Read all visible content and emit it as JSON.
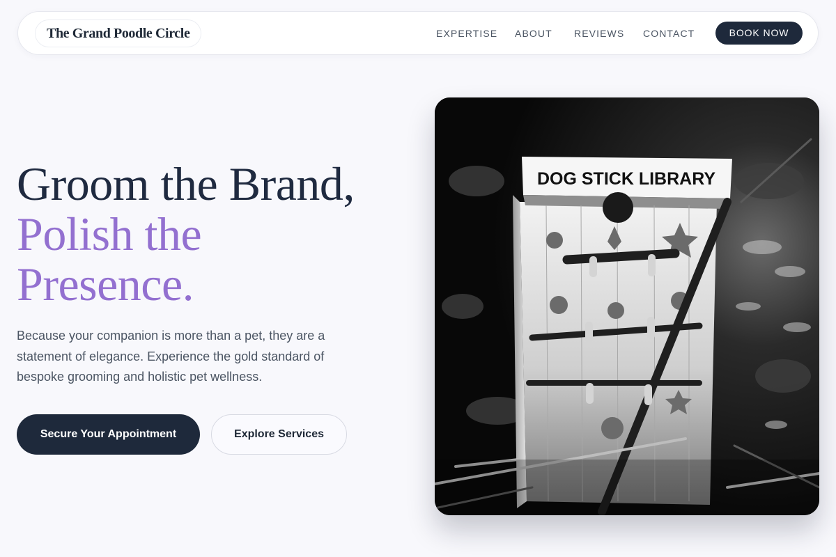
{
  "brand": {
    "name": "The Grand Poodle Circle"
  },
  "nav": {
    "links": [
      "EXPERTISE",
      "ABOUT",
      "REVIEWS",
      "CONTACT"
    ],
    "cta": "BOOK NOW"
  },
  "hero": {
    "headline_line1": "Groom the Brand,",
    "headline_line2": "Polish the",
    "headline_line3": "Presence.",
    "subtext": "Because your companion is more than a pet, they are a statement of elegance. Experience the gold standard of bespoke grooming and holistic pet wellness.",
    "primary_button": "Secure Your Appointment",
    "secondary_button": "Explore Services",
    "image": {
      "sign_text": "DOG STICK LIBRARY"
    }
  },
  "colors": {
    "dark": "#1e293b",
    "accent_purple": "#9370d0",
    "background": "#f8f8fc"
  }
}
